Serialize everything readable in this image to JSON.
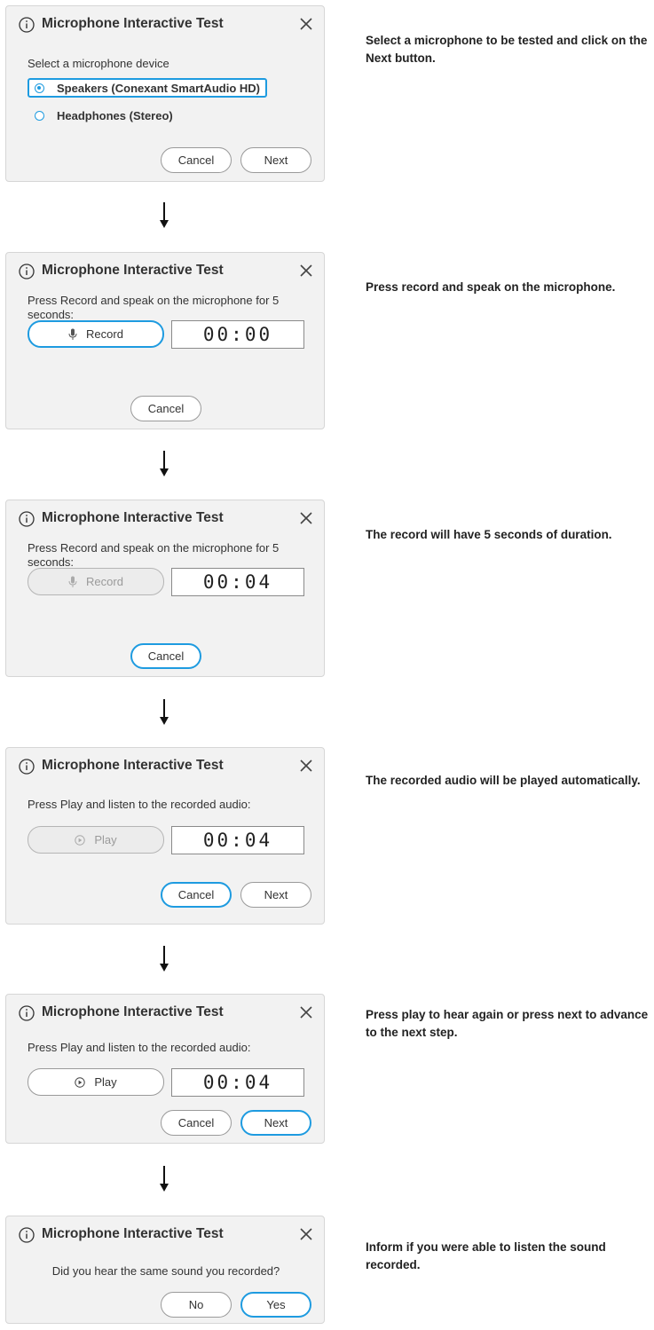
{
  "dialog_title": "Microphone Interactive Test",
  "steps": [
    {
      "prompt": "Select a microphone device",
      "devices": [
        "Speakers (Conexant SmartAudio HD)",
        "Headphones (Stereo)"
      ],
      "selected_device_index": 0,
      "cancel": "Cancel",
      "next": "Next",
      "caption": "Select a microphone to be tested and click on the Next button."
    },
    {
      "prompt": "Press Record and speak on the microphone for 5 seconds:",
      "record": "Record",
      "timer": "00:00",
      "cancel": "Cancel",
      "caption": "Press record and speak on the microphone."
    },
    {
      "prompt": "Press Record and speak on the microphone for 5 seconds:",
      "record": "Record",
      "timer": "00:04",
      "cancel": "Cancel",
      "caption": "The record will have 5 seconds of duration."
    },
    {
      "prompt": "Press Play and listen to the recorded audio:",
      "play": "Play",
      "timer": "00:04",
      "cancel": "Cancel",
      "next": "Next",
      "caption": "The recorded audio will be played automatically."
    },
    {
      "prompt": "Press Play and listen to the recorded audio:",
      "play": "Play",
      "timer": "00:04",
      "cancel": "Cancel",
      "next": "Next",
      "caption": "Press play to hear again or press next to advance to the next step."
    },
    {
      "prompt": "Did you hear the same sound you recorded?",
      "no": "No",
      "yes": "Yes",
      "caption": "Inform if you were able to listen the sound recorded."
    }
  ],
  "icons": {
    "info": "info-circle-icon",
    "close": "close-icon",
    "mic": "microphone-icon",
    "play": "play-circle-icon",
    "arrow": "down-arrow-icon"
  },
  "colors": {
    "accent": "#1e9be0",
    "dialog_bg": "#f2f2f2"
  }
}
